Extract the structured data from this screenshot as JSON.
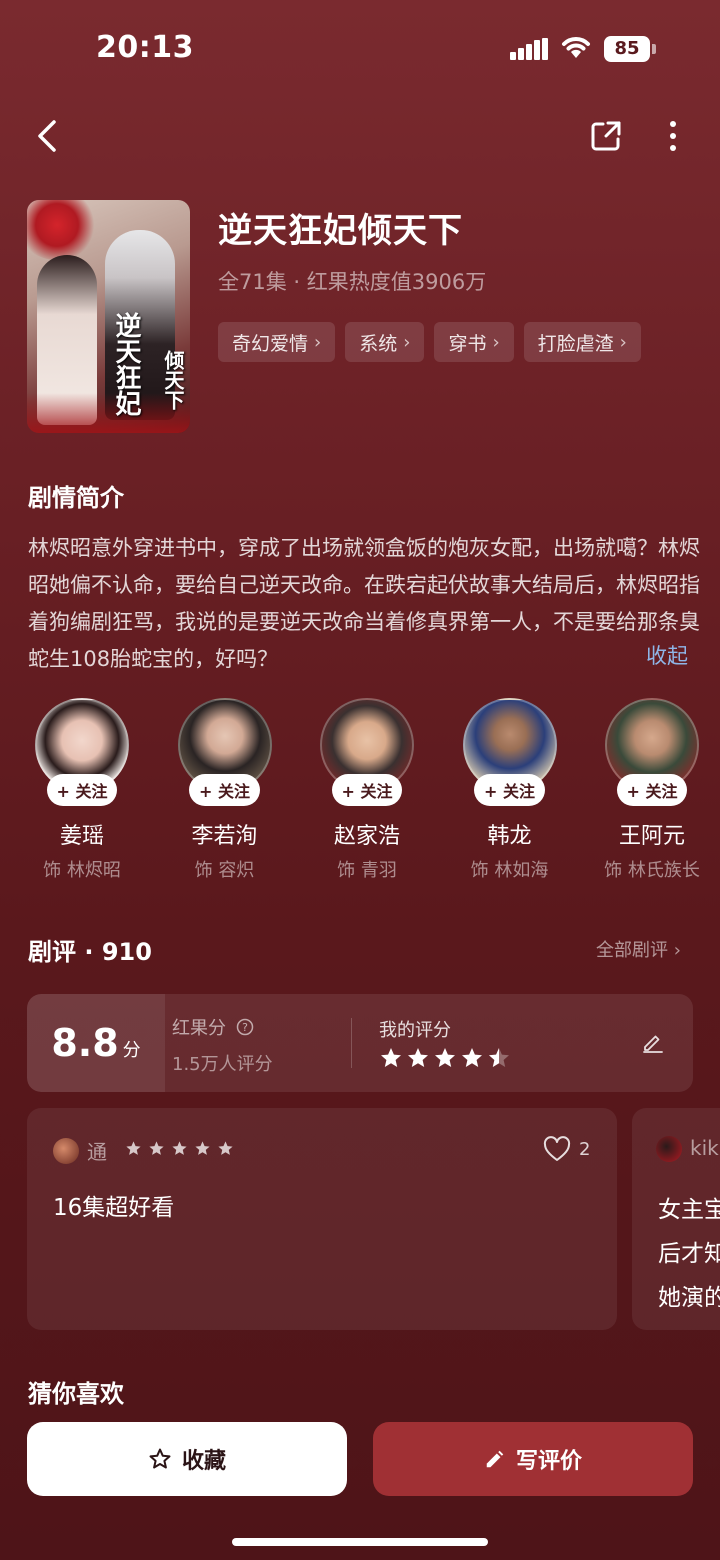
{
  "status_bar": {
    "time": "20:13",
    "battery": "85"
  },
  "drama": {
    "title": "逆天狂妃倾天下",
    "meta": "全71集 · 红果热度值3906万",
    "poster_text_main": "逆天狂妃",
    "poster_text_side": "倾天下",
    "tags": [
      "奇幻爱情",
      "系统",
      "穿书",
      "打脸虐渣"
    ]
  },
  "synopsis": {
    "heading": "剧情简介",
    "text": "林烬昭意外穿进书中，穿成了出场就领盒饭的炮灰女配，出场就噶？林烬昭她偏不认命，要给自己逆天改命。在跌宕起伏故事大结局后，林烬昭指着狗编剧狂骂，我说的是要逆天改命当着修真界第一人，不是要给那条臭蛇生108胎蛇宝的，好吗？",
    "collapse_label": "收起"
  },
  "cast": [
    {
      "name": "姜瑶",
      "role": "饰 林烬昭",
      "follow": "+ 关注"
    },
    {
      "name": "李若洵",
      "role": "饰 容炽",
      "follow": "+ 关注"
    },
    {
      "name": "赵家浩",
      "role": "饰 青羽",
      "follow": "+ 关注"
    },
    {
      "name": "韩龙",
      "role": "饰 林如海",
      "follow": "+ 关注"
    },
    {
      "name": "王阿元",
      "role": "饰 林氏族长",
      "follow": "+ 关注"
    }
  ],
  "reviews": {
    "heading": "剧评 · 910",
    "all_label": "全部剧评 ›",
    "score": "8.8",
    "score_unit": "分",
    "hongguo_label": "红果分",
    "rating_count": "1.5万人评分",
    "my_rating_label": "我的评分",
    "my_rating": 4.5,
    "items": [
      {
        "user": "通",
        "stars": 5,
        "likes": "2",
        "text": "16集超好看"
      },
      {
        "user": "kik",
        "text_lines": [
          "女主宝",
          "后才知",
          "她演的"
        ]
      }
    ]
  },
  "guess_heading": "猜你喜欢",
  "actions": {
    "favorite": "收藏",
    "write_review": "写评价"
  },
  "colors": {
    "accent": "#a03034",
    "link": "#8fb6e8",
    "background": "#6a2025"
  }
}
